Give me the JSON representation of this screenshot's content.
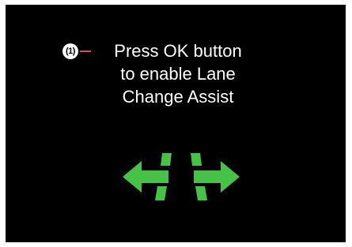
{
  "callout": {
    "number": "(1)"
  },
  "message": {
    "line1": "Press OK button",
    "line2": "to enable Lane",
    "line3": "Change Assist"
  },
  "icon": {
    "name": "lane-change-assist-icon",
    "color": "#46c246"
  },
  "colors": {
    "background": "#000000",
    "text": "#ffffff",
    "callout_line": "#d94a5c",
    "icon_green": "#46c246"
  }
}
